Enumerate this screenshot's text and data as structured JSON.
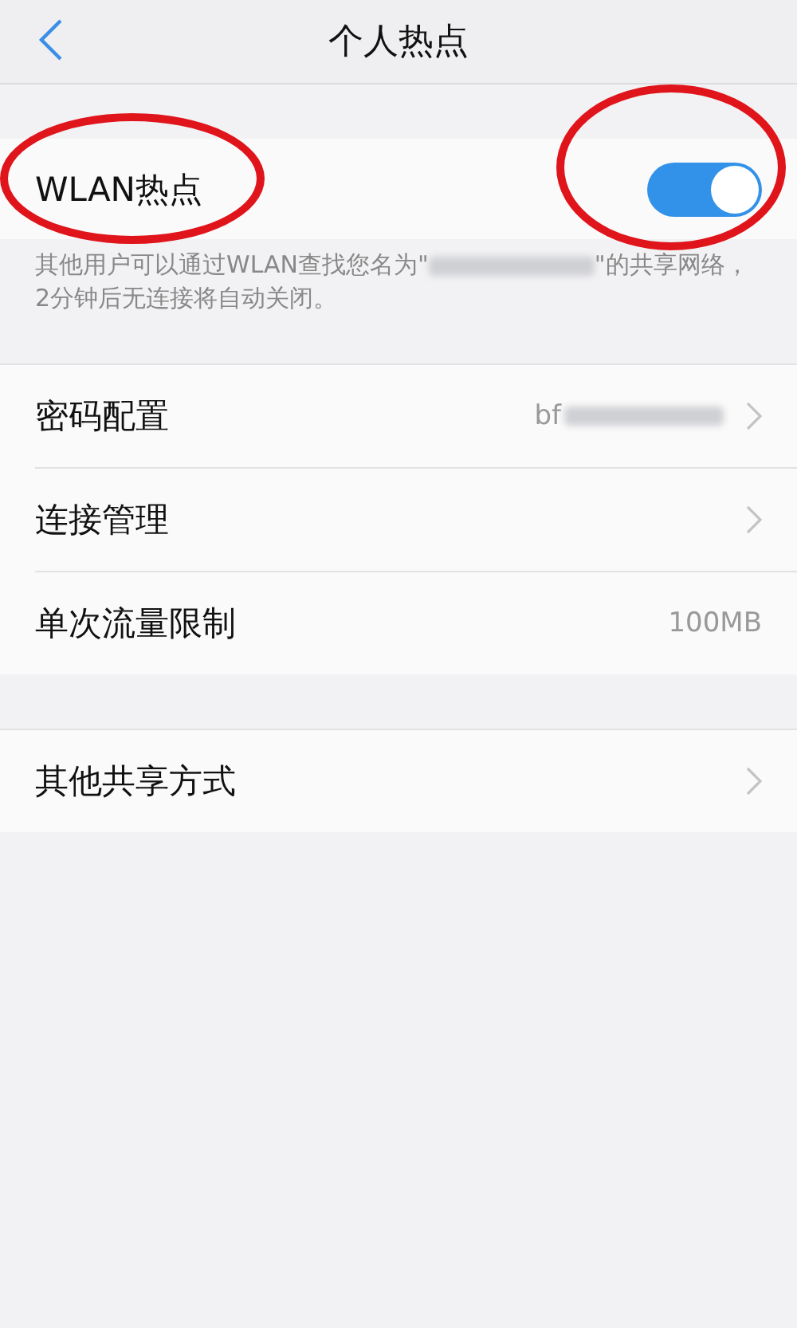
{
  "header": {
    "title": "个人热点"
  },
  "hotspot": {
    "label": "WLAN热点",
    "on": true,
    "label_circled": true,
    "toggle_circled": true
  },
  "description": [
    "其他用户可以通过WLAN查找您名为\"",
    "\"的共享网络，2分钟后无连接将自动关闭。"
  ],
  "groups": [
    {
      "rows": [
        {
          "label": "密码配置",
          "kind": "redacted_chevron",
          "value": "bf"
        },
        {
          "label": "连接管理",
          "kind": "chevron"
        },
        {
          "label": "单次流量限制",
          "kind": "value",
          "value": "100MB"
        }
      ]
    },
    {
      "rows": [
        {
          "label": "其他共享方式",
          "kind": "chevron"
        }
      ]
    }
  ]
}
